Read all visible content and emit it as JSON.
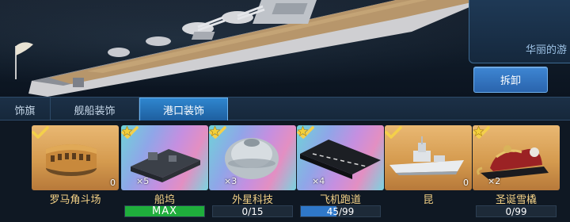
{
  "info": {
    "text": "华丽的游"
  },
  "actions": {
    "remove_label": "拆卸"
  },
  "tabs": [
    {
      "label": "饰旗",
      "active": false
    },
    {
      "label": "舰船装饰",
      "active": false
    },
    {
      "label": "港口装饰",
      "active": true
    }
  ],
  "items": [
    {
      "name": "罗马角斗场",
      "frame": "gold",
      "icon": "colosseum-icon",
      "checked": true,
      "count": "0",
      "stars": "",
      "progress_text": "",
      "progress": null
    },
    {
      "name": "船坞",
      "frame": "rainbow",
      "icon": "dock-icon",
      "checked": true,
      "count": "",
      "stars": "×5",
      "progress_text": "MAX",
      "progress": 1.0
    },
    {
      "name": "外星科技",
      "frame": "rainbow",
      "icon": "ufo-icon",
      "checked": true,
      "count": "",
      "stars": "×3",
      "progress_text": "0/15",
      "progress": 0.0
    },
    {
      "name": "飞机跑道",
      "frame": "rainbow",
      "icon": "runway-icon",
      "checked": true,
      "count": "",
      "stars": "×4",
      "progress_text": "45/99",
      "progress": 0.45
    },
    {
      "name": "昆",
      "frame": "gold",
      "icon": "warship-icon",
      "checked": true,
      "count": "0",
      "stars": "",
      "progress_text": "",
      "progress": null
    },
    {
      "name": "圣诞雪橇",
      "frame": "gold",
      "icon": "sleigh-icon",
      "checked": true,
      "count": "",
      "stars": "×2",
      "progress_text": "0/99",
      "progress": 0.0
    }
  ],
  "colors": {
    "accent": "#2f86cf",
    "gold_text": "#f3d186",
    "progress_green": "#1fae3c",
    "progress_blue": "#2f78c9"
  }
}
